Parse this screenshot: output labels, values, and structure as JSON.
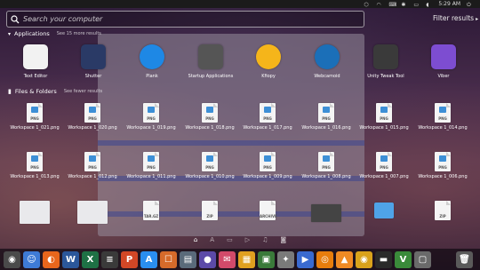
{
  "search": {
    "placeholder": "Search your computer"
  },
  "filter": {
    "label": "Filter results"
  },
  "top_panel": {
    "time": "5:29 AM"
  },
  "applications": {
    "header": "Applications",
    "more": "See 15 more results",
    "items": [
      {
        "label": "Text Editor",
        "icon": "text-editor-icon",
        "color": "#f2f2f2"
      },
      {
        "label": "Shutter",
        "icon": "shutter-icon",
        "color": "#2a3a66"
      },
      {
        "label": "Plank",
        "icon": "plank-icon",
        "color": "#1e88e5"
      },
      {
        "label": "Startup Applications",
        "icon": "startup-icon",
        "color": "#555555"
      },
      {
        "label": "Kfiopy",
        "icon": "radiation-icon",
        "color": "#f5b51a"
      },
      {
        "label": "Webcamoid",
        "icon": "webcam-icon",
        "color": "#1b6fb8"
      },
      {
        "label": "Unity Tweak Tool",
        "icon": "tools-icon",
        "color": "#3a3a3a"
      },
      {
        "label": "Viber",
        "icon": "viber-icon",
        "color": "#7d4dd1"
      }
    ]
  },
  "files": {
    "header": "Files & Folders",
    "more": "See fewer results",
    "row1": [
      {
        "label": "Workspace 1_021.png",
        "ext": "PNG"
      },
      {
        "label": "Workspace 1_020.png",
        "ext": "PNG"
      },
      {
        "label": "Workspace 1_019.png",
        "ext": "PNG"
      },
      {
        "label": "Workspace 1_018.png",
        "ext": "PNG"
      },
      {
        "label": "Workspace 1_017.png",
        "ext": "PNG"
      },
      {
        "label": "Workspace 1_016.png",
        "ext": "PNG"
      },
      {
        "label": "Workspace 1_015.png",
        "ext": "PNG"
      },
      {
        "label": "Workspace 1_014.png",
        "ext": "PNG"
      }
    ],
    "row2": [
      {
        "label": "Workspace 1_013.png",
        "ext": "PNG"
      },
      {
        "label": "Workspace 1_012.png",
        "ext": "PNG"
      },
      {
        "label": "Workspace 1_011.png",
        "ext": "PNG"
      },
      {
        "label": "Workspace 1_010.png",
        "ext": "PNG"
      },
      {
        "label": "Workspace 1_009.png",
        "ext": "PNG"
      },
      {
        "label": "Workspace 1_008.png",
        "ext": "PNG"
      },
      {
        "label": "Workspace 1_007.png",
        "ext": "PNG"
      },
      {
        "label": "Workspace 1_006.png",
        "ext": "PNG"
      }
    ],
    "row3": [
      {
        "label": "",
        "ext": "",
        "kind": "thumb"
      },
      {
        "label": "",
        "ext": "",
        "kind": "thumb"
      },
      {
        "label": "",
        "ext": "TAR.GZ",
        "kind": "doc"
      },
      {
        "label": "",
        "ext": "ZIP",
        "kind": "doc"
      },
      {
        "label": "",
        "ext": "ARCHIVE",
        "kind": "doc"
      },
      {
        "label": "",
        "ext": "",
        "kind": "dark"
      },
      {
        "label": "",
        "ext": "",
        "kind": "folder"
      },
      {
        "label": "",
        "ext": "ZIP",
        "kind": "doc"
      }
    ]
  },
  "lenses": [
    {
      "name": "home-lens-icon",
      "glyph": "⌂"
    },
    {
      "name": "apps-lens-icon",
      "glyph": "A"
    },
    {
      "name": "files-lens-icon",
      "glyph": "▭"
    },
    {
      "name": "video-lens-icon",
      "glyph": "▷"
    },
    {
      "name": "music-lens-icon",
      "glyph": "♫"
    },
    {
      "name": "photo-lens-icon",
      "glyph": "◙"
    }
  ],
  "dock": [
    {
      "name": "ubuntu-settings-icon",
      "color": "#4a4a4a",
      "glyph": "◉"
    },
    {
      "name": "finder-icon",
      "color": "#3e7bd6",
      "glyph": "☺"
    },
    {
      "name": "firefox-icon",
      "color": "#e8661c",
      "glyph": "◐"
    },
    {
      "name": "word-icon",
      "color": "#2b579a",
      "glyph": "W"
    },
    {
      "name": "excel-icon",
      "color": "#1e7145",
      "glyph": "X"
    },
    {
      "name": "wps-icon",
      "color": "#3a3a3a",
      "glyph": "≡"
    },
    {
      "name": "powerpoint-icon",
      "color": "#d24726",
      "glyph": "P"
    },
    {
      "name": "app-store-icon",
      "color": "#2a8ef0",
      "glyph": "A"
    },
    {
      "name": "software-center-icon",
      "color": "#d66a2a",
      "glyph": "☐"
    },
    {
      "name": "files-icon",
      "color": "#5a6a7a",
      "glyph": "▤"
    },
    {
      "name": "space-icon",
      "color": "#5c4aa8",
      "glyph": "●"
    },
    {
      "name": "mail-icon",
      "color": "#d24a6a",
      "glyph": "✉"
    },
    {
      "name": "clapper-icon",
      "color": "#e0a020",
      "glyph": "▦"
    },
    {
      "name": "notes-icon",
      "color": "#3a7a3a",
      "glyph": "▣"
    },
    {
      "name": "compass-icon",
      "color": "#7a7a7a",
      "glyph": "✦"
    },
    {
      "name": "video-editor-icon",
      "color": "#3a6ad0",
      "glyph": "▶"
    },
    {
      "name": "blender-icon",
      "color": "#e87d0d",
      "glyph": "◎"
    },
    {
      "name": "vlc-icon",
      "color": "#f08a24",
      "glyph": "▲"
    },
    {
      "name": "chrome-icon",
      "color": "#d9a21b",
      "glyph": "◉"
    },
    {
      "name": "terminal-icon",
      "color": "#2a2a2a",
      "glyph": "▬"
    },
    {
      "name": "vim-icon",
      "color": "#3a8a3a",
      "glyph": "V"
    },
    {
      "name": "screenshot-icon",
      "color": "#6a6a6a",
      "glyph": "▢"
    }
  ]
}
